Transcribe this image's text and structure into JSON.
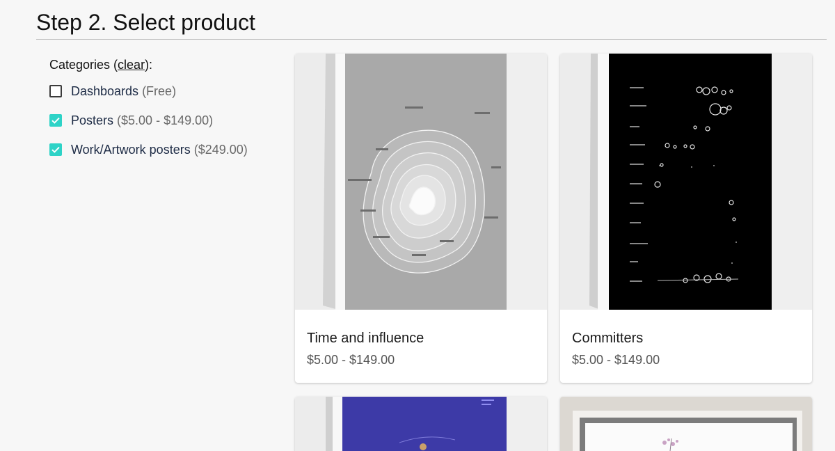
{
  "heading": "Step 2. Select product",
  "categories": {
    "label_prefix": "Categories (",
    "clear_label": "clear",
    "label_suffix": "):",
    "items": [
      {
        "name": "Dashboards",
        "price": "(Free)",
        "checked": false
      },
      {
        "name": "Posters",
        "price": "($5.00 - $149.00)",
        "checked": true
      },
      {
        "name": "Work/Artwork posters",
        "price": "($249.00)",
        "checked": true
      }
    ]
  },
  "products": [
    {
      "title": "Time and influence",
      "price": "$5.00 - $149.00"
    },
    {
      "title": "Committers",
      "price": "$5.00 - $149.00"
    }
  ],
  "colors": {
    "accent": "#2ed3c7",
    "poster_gray": "#a7a7a7",
    "poster_black": "#000000",
    "poster_purple": "#3d3aa7"
  }
}
